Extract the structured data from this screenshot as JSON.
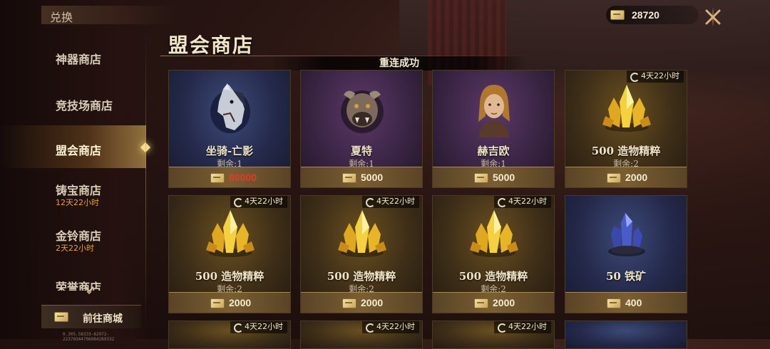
{
  "sidebar": {
    "title": "兑换",
    "items": [
      {
        "label": "神器商店",
        "sub": ""
      },
      {
        "label": "竞技场商店",
        "sub": ""
      },
      {
        "label": "盟会商店",
        "sub": ""
      },
      {
        "label": "铸宝商店",
        "sub": "12天22小时"
      },
      {
        "label": "金铃商店",
        "sub": "2天22小时"
      },
      {
        "label": "荣誉商店",
        "sub": ""
      }
    ],
    "active_index": 2,
    "goto_label": "前往商城",
    "build_id": "0.305.58333-62972-22370344706084289332"
  },
  "header": {
    "title": "盟会商店",
    "toast": "重连成功",
    "currency_value": "28720"
  },
  "cards": [
    {
      "name": "坐骑-亡影",
      "stock": "剩余:1",
      "price": "80000",
      "price_insufficient": true,
      "icon": "horse-icon",
      "theme": "blue",
      "timer": ""
    },
    {
      "name": "夏特",
      "stock": "剩余:1",
      "price": "5000",
      "price_insufficient": false,
      "icon": "beast-portrait-icon",
      "theme": "purple",
      "timer": ""
    },
    {
      "name": "赫吉欧",
      "stock": "剩余:1",
      "price": "5000",
      "price_insufficient": false,
      "icon": "hero-portrait-icon",
      "theme": "purple",
      "timer": ""
    },
    {
      "name": "500 造物精粹",
      "stock": "剩余:2",
      "price": "2000",
      "price_insufficient": false,
      "icon": "gold-crystal-icon",
      "theme": "gold",
      "timer": "4天22小时"
    },
    {
      "name": "500 造物精粹",
      "stock": "剩余:2",
      "price": "2000",
      "price_insufficient": false,
      "icon": "gold-crystal-icon",
      "theme": "gold",
      "timer": "4天22小时"
    },
    {
      "name": "500 造物精粹",
      "stock": "剩余:2",
      "price": "2000",
      "price_insufficient": false,
      "icon": "gold-crystal-icon",
      "theme": "gold",
      "timer": "4天22小时"
    },
    {
      "name": "500 造物精粹",
      "stock": "剩余:2",
      "price": "2000",
      "price_insufficient": false,
      "icon": "gold-crystal-icon",
      "theme": "gold",
      "timer": "4天22小时"
    },
    {
      "name": "50 铁矿",
      "stock": "",
      "price": "400",
      "price_insufficient": false,
      "icon": "iron-ore-icon",
      "theme": "blue",
      "timer": "4天22小时"
    }
  ],
  "next_row_timers": [
    "4天22小时",
    "4天22小时",
    "4天22小时"
  ],
  "colors": {
    "insufficient": "#e23a2a",
    "accent_gold": "#f6dc8a"
  }
}
